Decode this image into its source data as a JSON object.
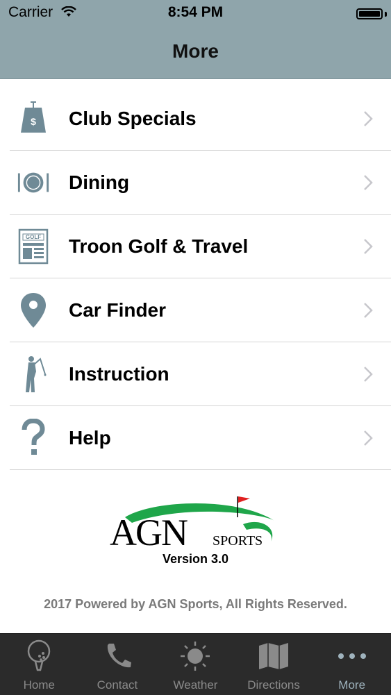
{
  "status_bar": {
    "carrier": "Carrier",
    "time": "8:54 PM",
    "battery_level": 1.0
  },
  "nav": {
    "title": "More"
  },
  "menu": {
    "items": [
      {
        "label": "Club Specials",
        "icon": "price-tag-icon"
      },
      {
        "label": "Dining",
        "icon": "plate-utensils-icon"
      },
      {
        "label": "Troon Golf & Travel",
        "icon": "newspaper-icon",
        "icon_text": "GOLF"
      },
      {
        "label": "Car Finder",
        "icon": "map-pin-icon"
      },
      {
        "label": "Instruction",
        "icon": "golfer-icon"
      },
      {
        "label": "Help",
        "icon": "question-mark-icon"
      }
    ]
  },
  "branding": {
    "logo_text": "AGN",
    "logo_sub": "SPORTS",
    "version": "Version 3.0",
    "footer": "2017 Powered by AGN Sports, All Rights Reserved."
  },
  "tab_bar": {
    "tabs": [
      {
        "label": "Home",
        "icon": "golf-ball-icon",
        "active": false
      },
      {
        "label": "Contact",
        "icon": "phone-icon",
        "active": false
      },
      {
        "label": "Weather",
        "icon": "sun-icon",
        "active": false
      },
      {
        "label": "Directions",
        "icon": "map-icon",
        "active": false
      },
      {
        "label": "More",
        "icon": "more-dots-icon",
        "active": true
      }
    ]
  },
  "colors": {
    "nav_bar": "#8fa5ab",
    "icon": "#6f8a96",
    "tab_bar": "#2b2b2b",
    "tab_active": "#9fb3bd",
    "logo_green": "#1fa64a",
    "logo_flag": "#e02020"
  }
}
